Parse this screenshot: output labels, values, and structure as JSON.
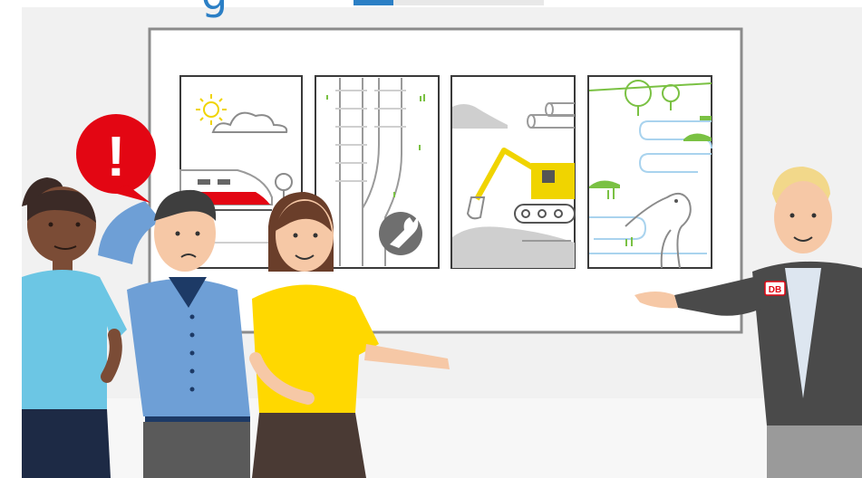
{
  "headline_fragment": "g",
  "badge": {
    "text": "DB",
    "color": "#e30613"
  },
  "alert": {
    "symbol": "!",
    "color": "#e30613"
  },
  "colors": {
    "accent_blue": "#2b7fc5",
    "wall": "#f1f1f1",
    "board": "#ffffff",
    "sun": "#f0d400",
    "train_red": "#e30613",
    "excavator": "#f0d400",
    "green": "#7ac143",
    "water": "#a9d3ee",
    "shirt_cyan": "#6cc6e4",
    "shirt_blue": "#6e9fd6",
    "top_yellow": "#ffd800",
    "jacket_gray": "#4a4a4a"
  },
  "panels": [
    "sun-train-panel",
    "track-repair-panel",
    "excavator-panel",
    "nature-heron-panel"
  ]
}
